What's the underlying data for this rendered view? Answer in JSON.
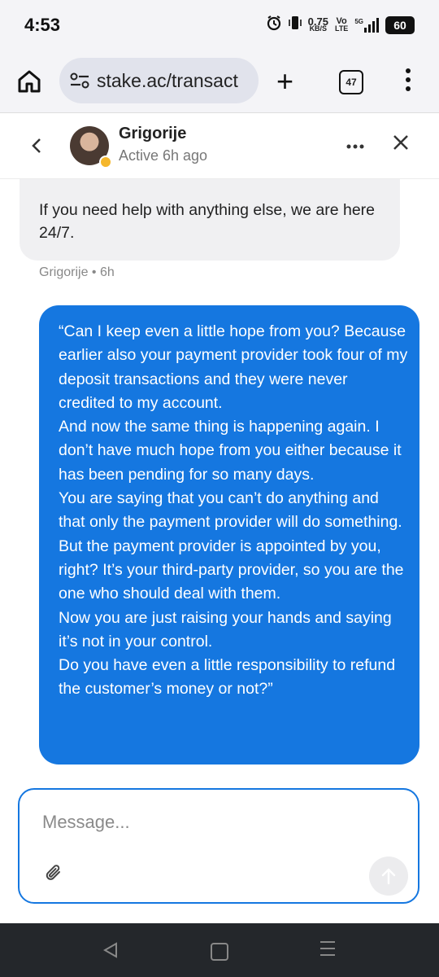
{
  "status_bar": {
    "time": "4:53",
    "net_speed_value": "0.75",
    "net_speed_unit": "KB/S",
    "volte_top": "Vo",
    "volte_bottom": "LTE",
    "network": "5G",
    "battery": "60"
  },
  "browser": {
    "url": "stake.ac/transact",
    "tab_count": "47"
  },
  "chat_header": {
    "agent_name": "Grigorije",
    "agent_status": "Active 6h ago",
    "status_color": "#f5b72c"
  },
  "messages": {
    "incoming_text": "If you need help with anything else, we are here 24/7.",
    "incoming_meta": "Grigorije • 6h",
    "outgoing_text": "“Can I keep even a little hope from you? Because earlier also your payment provider took four of my deposit transactions and they were never credited to my account.\nAnd now the same thing is happening again. I don’t have much hope from you either because it has been pending for so many days.\nYou are saying that you can’t do anything and that only the payment provider will do something.\nBut the payment provider is appointed by you, right? It’s your third-party provider, so you are the one who should deal with them.\nNow you are just raising your hands and saying it’s not in your control.\nDo you have even a little responsibility to refund the customer’s money or not?”",
    "outgoing_color": "#1577e0"
  },
  "composer": {
    "placeholder": "Message...",
    "value": ""
  },
  "icons": {
    "home": "home-icon",
    "site_settings": "tune-icon",
    "new_tab": "plus-icon",
    "tabs": "tabs-icon",
    "menu": "more-vert-icon",
    "back": "chevron-left-icon",
    "more": "more-horiz-icon",
    "close": "close-icon",
    "attach": "paperclip-icon",
    "send": "arrow-up-icon"
  }
}
